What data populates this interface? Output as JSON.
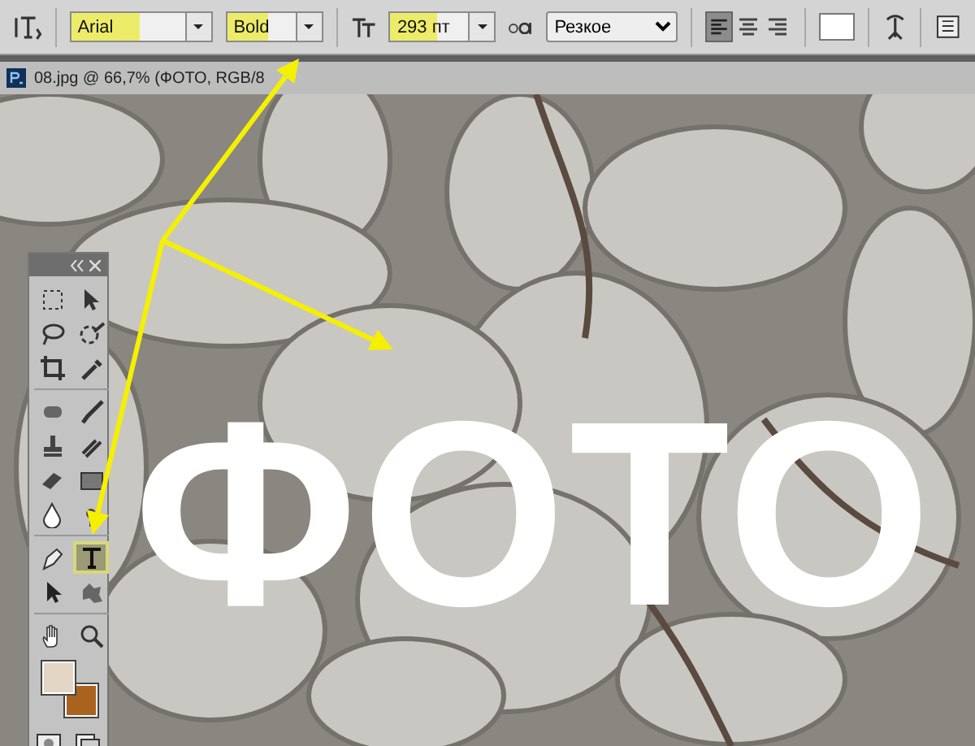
{
  "options_bar": {
    "font_family": {
      "value": "Arial",
      "highlighted": true
    },
    "font_style": {
      "value": "Bold",
      "highlighted": true
    },
    "font_size": {
      "value": "293 пт",
      "highlighted": true
    },
    "antialias": {
      "value": "Резкое"
    },
    "align": [
      {
        "kind": "left",
        "selected": true
      },
      {
        "kind": "center",
        "selected": false
      },
      {
        "kind": "right",
        "selected": false
      }
    ]
  },
  "document_tab": {
    "title": "08.jpg @ 66,7% (ФОТО, RGB/8"
  },
  "canvas": {
    "text": "ФОТО"
  },
  "toolbox": {
    "tools": [
      {
        "kind": "marquee",
        "selected": false
      },
      {
        "kind": "move",
        "selected": false
      },
      {
        "kind": "lasso",
        "selected": false
      },
      {
        "kind": "quick-select",
        "selected": false
      },
      {
        "kind": "crop",
        "selected": false
      },
      {
        "kind": "eyedropper",
        "selected": false
      },
      {
        "kind": "sep"
      },
      {
        "kind": "heal",
        "selected": false
      },
      {
        "kind": "brush",
        "selected": false
      },
      {
        "kind": "stamp",
        "selected": false
      },
      {
        "kind": "history",
        "selected": false
      },
      {
        "kind": "eraser",
        "selected": false
      },
      {
        "kind": "gradient",
        "selected": false
      },
      {
        "kind": "drop",
        "selected": false
      },
      {
        "kind": "dodge",
        "selected": false
      },
      {
        "kind": "sep"
      },
      {
        "kind": "pen",
        "selected": false
      },
      {
        "kind": "type",
        "selected": true
      },
      {
        "kind": "arrow",
        "selected": false
      },
      {
        "kind": "shape",
        "selected": false
      },
      {
        "kind": "sep"
      },
      {
        "kind": "hand",
        "selected": false
      },
      {
        "kind": "zoom",
        "selected": false
      }
    ]
  }
}
